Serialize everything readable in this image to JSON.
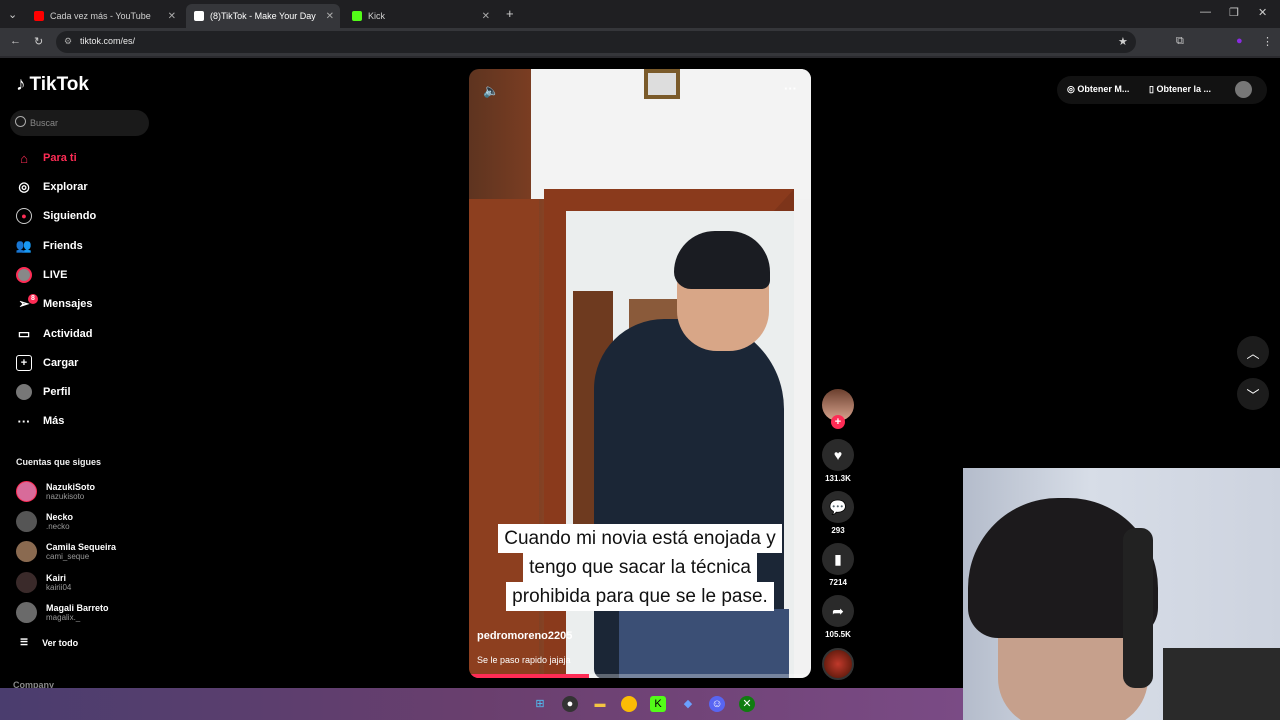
{
  "browser": {
    "tabs": [
      {
        "title": "Cada vez más - YouTube",
        "color": "#ff0000"
      },
      {
        "title": "(8)TikTok - Make Your Day",
        "color": "#ffffff"
      },
      {
        "title": "Kick",
        "color": "#53fc18"
      }
    ],
    "url": "tiktok.com/es/"
  },
  "sidebar": {
    "logo": "TikTok",
    "search_placeholder": "Buscar",
    "nav": [
      {
        "label": "Para ti",
        "icon": "home-icon"
      },
      {
        "label": "Explorar",
        "icon": "compass-icon"
      },
      {
        "label": "Siguiendo",
        "icon": "following-icon"
      },
      {
        "label": "Friends",
        "icon": "friends-icon"
      },
      {
        "label": "LIVE",
        "icon": "live-icon"
      },
      {
        "label": "Mensajes",
        "icon": "messages-icon",
        "badge": "8"
      },
      {
        "label": "Actividad",
        "icon": "activity-icon"
      },
      {
        "label": "Cargar",
        "icon": "upload-icon"
      },
      {
        "label": "Perfil",
        "icon": "profile-icon"
      },
      {
        "label": "Más",
        "icon": "more-icon"
      }
    ],
    "following_title": "Cuentas que sigues",
    "accounts": [
      {
        "name": "NazukiSoto",
        "handle": "nazukisoto"
      },
      {
        "name": "Necko",
        "handle": ".necko"
      },
      {
        "name": "Camila Sequeira",
        "handle": "cami_seque"
      },
      {
        "name": "Kairi",
        "handle": "kairii04"
      },
      {
        "name": "Magali Barreto",
        "handle": "magalix._"
      }
    ],
    "see_all": "Ver todo",
    "company": "Company"
  },
  "video": {
    "caption_lines": [
      "Cuando mi novia está enojada y",
      "tengo que sacar la técnica",
      "prohibida para que se le pase."
    ],
    "username": "pedromoreno2205",
    "description": "Se le paso rapido jajaja",
    "progress": 0.35
  },
  "actions": {
    "likes": "131.3K",
    "comments": "293",
    "saves": "7214",
    "shares": "105.5K"
  },
  "topbar": {
    "btn1": "Obtener M...",
    "btn2": "Obtener la ..."
  }
}
